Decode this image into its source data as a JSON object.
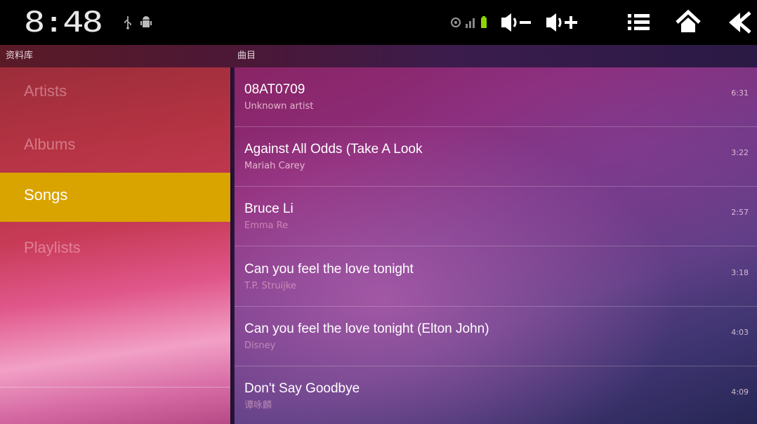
{
  "status_bar": {
    "time": "8:48",
    "icons": [
      "usb-icon",
      "android-debug-icon",
      "sync-icon",
      "signal-icon",
      "battery-icon",
      "volume-down-icon",
      "volume-up-icon",
      "menu-icon",
      "home-icon",
      "back-icon"
    ],
    "battery_color": "#8ed400"
  },
  "headers": {
    "library": "资料库",
    "tracks": "曲目"
  },
  "library": {
    "items": [
      {
        "label": "Artists"
      },
      {
        "label": "Albums"
      },
      {
        "label": "Songs"
      },
      {
        "label": "Playlists"
      }
    ],
    "selected_color": "#d9a300"
  },
  "songs": [
    {
      "title": "08AT0709",
      "artist": "Unknown artist",
      "duration": "6:31"
    },
    {
      "title": "Against All Odds (Take A Look",
      "artist": "Mariah Carey",
      "duration": "3:22"
    },
    {
      "title": "Bruce Li",
      "artist": "Emma Re",
      "duration": "2:57"
    },
    {
      "title": "Can you feel the love tonight",
      "artist": "T.P. Struijke",
      "duration": "3:18"
    },
    {
      "title": "Can you feel the love tonight (Elton John)",
      "artist": "Disney",
      "duration": "4:03"
    },
    {
      "title": "Don't Say Goodbye",
      "artist": "谭咏麟",
      "duration": "4:09"
    }
  ]
}
